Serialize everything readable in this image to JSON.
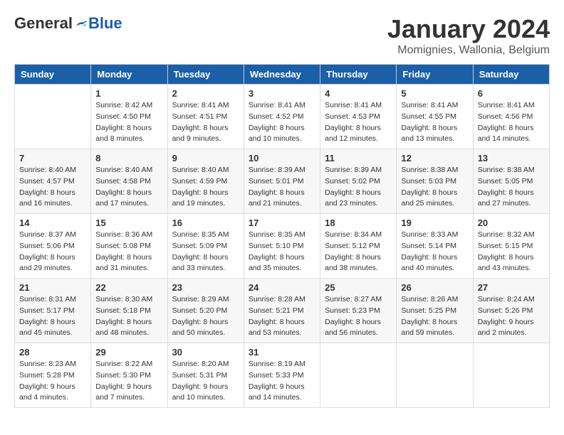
{
  "logo": {
    "general": "General",
    "blue": "Blue"
  },
  "header": {
    "month": "January 2024",
    "location": "Momignies, Wallonia, Belgium"
  },
  "weekdays": [
    "Sunday",
    "Monday",
    "Tuesday",
    "Wednesday",
    "Thursday",
    "Friday",
    "Saturday"
  ],
  "weeks": [
    [
      {
        "day": "",
        "sunrise": "",
        "sunset": "",
        "daylight": ""
      },
      {
        "day": "1",
        "sunrise": "Sunrise: 8:42 AM",
        "sunset": "Sunset: 4:50 PM",
        "daylight": "Daylight: 8 hours and 8 minutes."
      },
      {
        "day": "2",
        "sunrise": "Sunrise: 8:41 AM",
        "sunset": "Sunset: 4:51 PM",
        "daylight": "Daylight: 8 hours and 9 minutes."
      },
      {
        "day": "3",
        "sunrise": "Sunrise: 8:41 AM",
        "sunset": "Sunset: 4:52 PM",
        "daylight": "Daylight: 8 hours and 10 minutes."
      },
      {
        "day": "4",
        "sunrise": "Sunrise: 8:41 AM",
        "sunset": "Sunset: 4:53 PM",
        "daylight": "Daylight: 8 hours and 12 minutes."
      },
      {
        "day": "5",
        "sunrise": "Sunrise: 8:41 AM",
        "sunset": "Sunset: 4:55 PM",
        "daylight": "Daylight: 8 hours and 13 minutes."
      },
      {
        "day": "6",
        "sunrise": "Sunrise: 8:41 AM",
        "sunset": "Sunset: 4:56 PM",
        "daylight": "Daylight: 8 hours and 14 minutes."
      }
    ],
    [
      {
        "day": "7",
        "sunrise": "Sunrise: 8:40 AM",
        "sunset": "Sunset: 4:57 PM",
        "daylight": "Daylight: 8 hours and 16 minutes."
      },
      {
        "day": "8",
        "sunrise": "Sunrise: 8:40 AM",
        "sunset": "Sunset: 4:58 PM",
        "daylight": "Daylight: 8 hours and 17 minutes."
      },
      {
        "day": "9",
        "sunrise": "Sunrise: 8:40 AM",
        "sunset": "Sunset: 4:59 PM",
        "daylight": "Daylight: 8 hours and 19 minutes."
      },
      {
        "day": "10",
        "sunrise": "Sunrise: 8:39 AM",
        "sunset": "Sunset: 5:01 PM",
        "daylight": "Daylight: 8 hours and 21 minutes."
      },
      {
        "day": "11",
        "sunrise": "Sunrise: 8:39 AM",
        "sunset": "Sunset: 5:02 PM",
        "daylight": "Daylight: 8 hours and 23 minutes."
      },
      {
        "day": "12",
        "sunrise": "Sunrise: 8:38 AM",
        "sunset": "Sunset: 5:03 PM",
        "daylight": "Daylight: 8 hours and 25 minutes."
      },
      {
        "day": "13",
        "sunrise": "Sunrise: 8:38 AM",
        "sunset": "Sunset: 5:05 PM",
        "daylight": "Daylight: 8 hours and 27 minutes."
      }
    ],
    [
      {
        "day": "14",
        "sunrise": "Sunrise: 8:37 AM",
        "sunset": "Sunset: 5:06 PM",
        "daylight": "Daylight: 8 hours and 29 minutes."
      },
      {
        "day": "15",
        "sunrise": "Sunrise: 8:36 AM",
        "sunset": "Sunset: 5:08 PM",
        "daylight": "Daylight: 8 hours and 31 minutes."
      },
      {
        "day": "16",
        "sunrise": "Sunrise: 8:35 AM",
        "sunset": "Sunset: 5:09 PM",
        "daylight": "Daylight: 8 hours and 33 minutes."
      },
      {
        "day": "17",
        "sunrise": "Sunrise: 8:35 AM",
        "sunset": "Sunset: 5:10 PM",
        "daylight": "Daylight: 8 hours and 35 minutes."
      },
      {
        "day": "18",
        "sunrise": "Sunrise: 8:34 AM",
        "sunset": "Sunset: 5:12 PM",
        "daylight": "Daylight: 8 hours and 38 minutes."
      },
      {
        "day": "19",
        "sunrise": "Sunrise: 8:33 AM",
        "sunset": "Sunset: 5:14 PM",
        "daylight": "Daylight: 8 hours and 40 minutes."
      },
      {
        "day": "20",
        "sunrise": "Sunrise: 8:32 AM",
        "sunset": "Sunset: 5:15 PM",
        "daylight": "Daylight: 8 hours and 43 minutes."
      }
    ],
    [
      {
        "day": "21",
        "sunrise": "Sunrise: 8:31 AM",
        "sunset": "Sunset: 5:17 PM",
        "daylight": "Daylight: 8 hours and 45 minutes."
      },
      {
        "day": "22",
        "sunrise": "Sunrise: 8:30 AM",
        "sunset": "Sunset: 5:18 PM",
        "daylight": "Daylight: 8 hours and 48 minutes."
      },
      {
        "day": "23",
        "sunrise": "Sunrise: 8:29 AM",
        "sunset": "Sunset: 5:20 PM",
        "daylight": "Daylight: 8 hours and 50 minutes."
      },
      {
        "day": "24",
        "sunrise": "Sunrise: 8:28 AM",
        "sunset": "Sunset: 5:21 PM",
        "daylight": "Daylight: 8 hours and 53 minutes."
      },
      {
        "day": "25",
        "sunrise": "Sunrise: 8:27 AM",
        "sunset": "Sunset: 5:23 PM",
        "daylight": "Daylight: 8 hours and 56 minutes."
      },
      {
        "day": "26",
        "sunrise": "Sunrise: 8:26 AM",
        "sunset": "Sunset: 5:25 PM",
        "daylight": "Daylight: 8 hours and 59 minutes."
      },
      {
        "day": "27",
        "sunrise": "Sunrise: 8:24 AM",
        "sunset": "Sunset: 5:26 PM",
        "daylight": "Daylight: 9 hours and 2 minutes."
      }
    ],
    [
      {
        "day": "28",
        "sunrise": "Sunrise: 8:23 AM",
        "sunset": "Sunset: 5:28 PM",
        "daylight": "Daylight: 9 hours and 4 minutes."
      },
      {
        "day": "29",
        "sunrise": "Sunrise: 8:22 AM",
        "sunset": "Sunset: 5:30 PM",
        "daylight": "Daylight: 9 hours and 7 minutes."
      },
      {
        "day": "30",
        "sunrise": "Sunrise: 8:20 AM",
        "sunset": "Sunset: 5:31 PM",
        "daylight": "Daylight: 9 hours and 10 minutes."
      },
      {
        "day": "31",
        "sunrise": "Sunrise: 8:19 AM",
        "sunset": "Sunset: 5:33 PM",
        "daylight": "Daylight: 9 hours and 14 minutes."
      },
      {
        "day": "",
        "sunrise": "",
        "sunset": "",
        "daylight": ""
      },
      {
        "day": "",
        "sunrise": "",
        "sunset": "",
        "daylight": ""
      },
      {
        "day": "",
        "sunrise": "",
        "sunset": "",
        "daylight": ""
      }
    ]
  ]
}
